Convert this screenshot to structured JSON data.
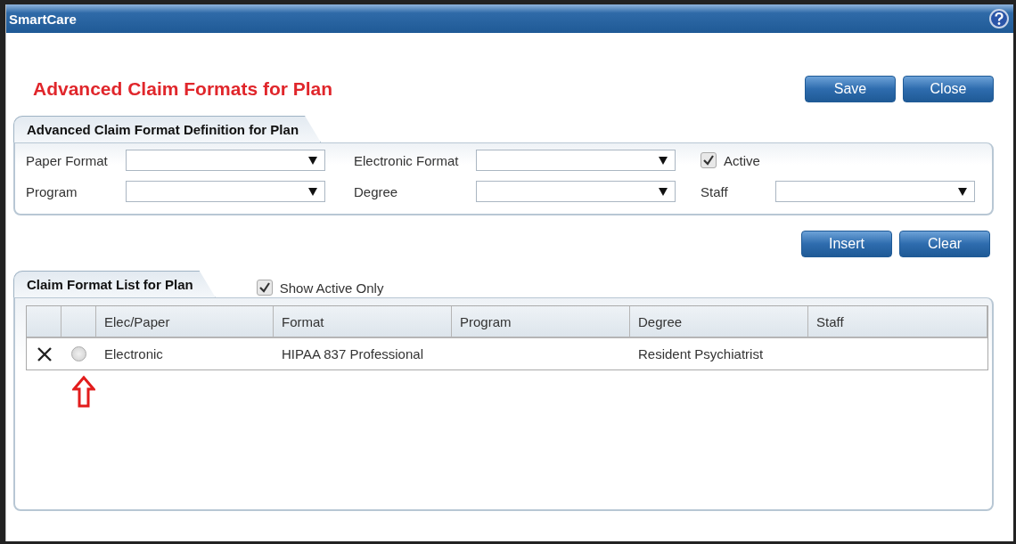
{
  "window": {
    "title": "SmartCare"
  },
  "heading": "Advanced Claim Formats for Plan",
  "top_buttons": [
    "Save",
    "Close"
  ],
  "definition": {
    "title": "Advanced Claim Format Definition for Plan",
    "fields": [
      {
        "kind": "dropdown",
        "label": "Paper Format"
      },
      {
        "kind": "dropdown",
        "label": "Electronic Format"
      },
      {
        "kind": "checkbox",
        "label": "Active",
        "checked": true
      },
      {
        "kind": "dropdown",
        "label": "Program"
      },
      {
        "kind": "dropdown",
        "label": "Degree"
      },
      {
        "kind": "dropdown",
        "label": "Staff"
      }
    ]
  },
  "list_buttons": [
    "Insert",
    "Clear"
  ],
  "list": {
    "title": "Claim Format List for Plan",
    "show_active_only": {
      "label": "Show Active Only",
      "checked": true
    },
    "columns": [
      "Elec/Paper",
      "Format",
      "Program",
      "Degree",
      "Staff"
    ],
    "rows": [
      {
        "selected": false,
        "cells": [
          "Electronic",
          "HIPAA 837 Professional",
          "",
          "Resident Psychiatrist",
          ""
        ]
      }
    ]
  },
  "annotation": {
    "kind": "arrow"
  }
}
